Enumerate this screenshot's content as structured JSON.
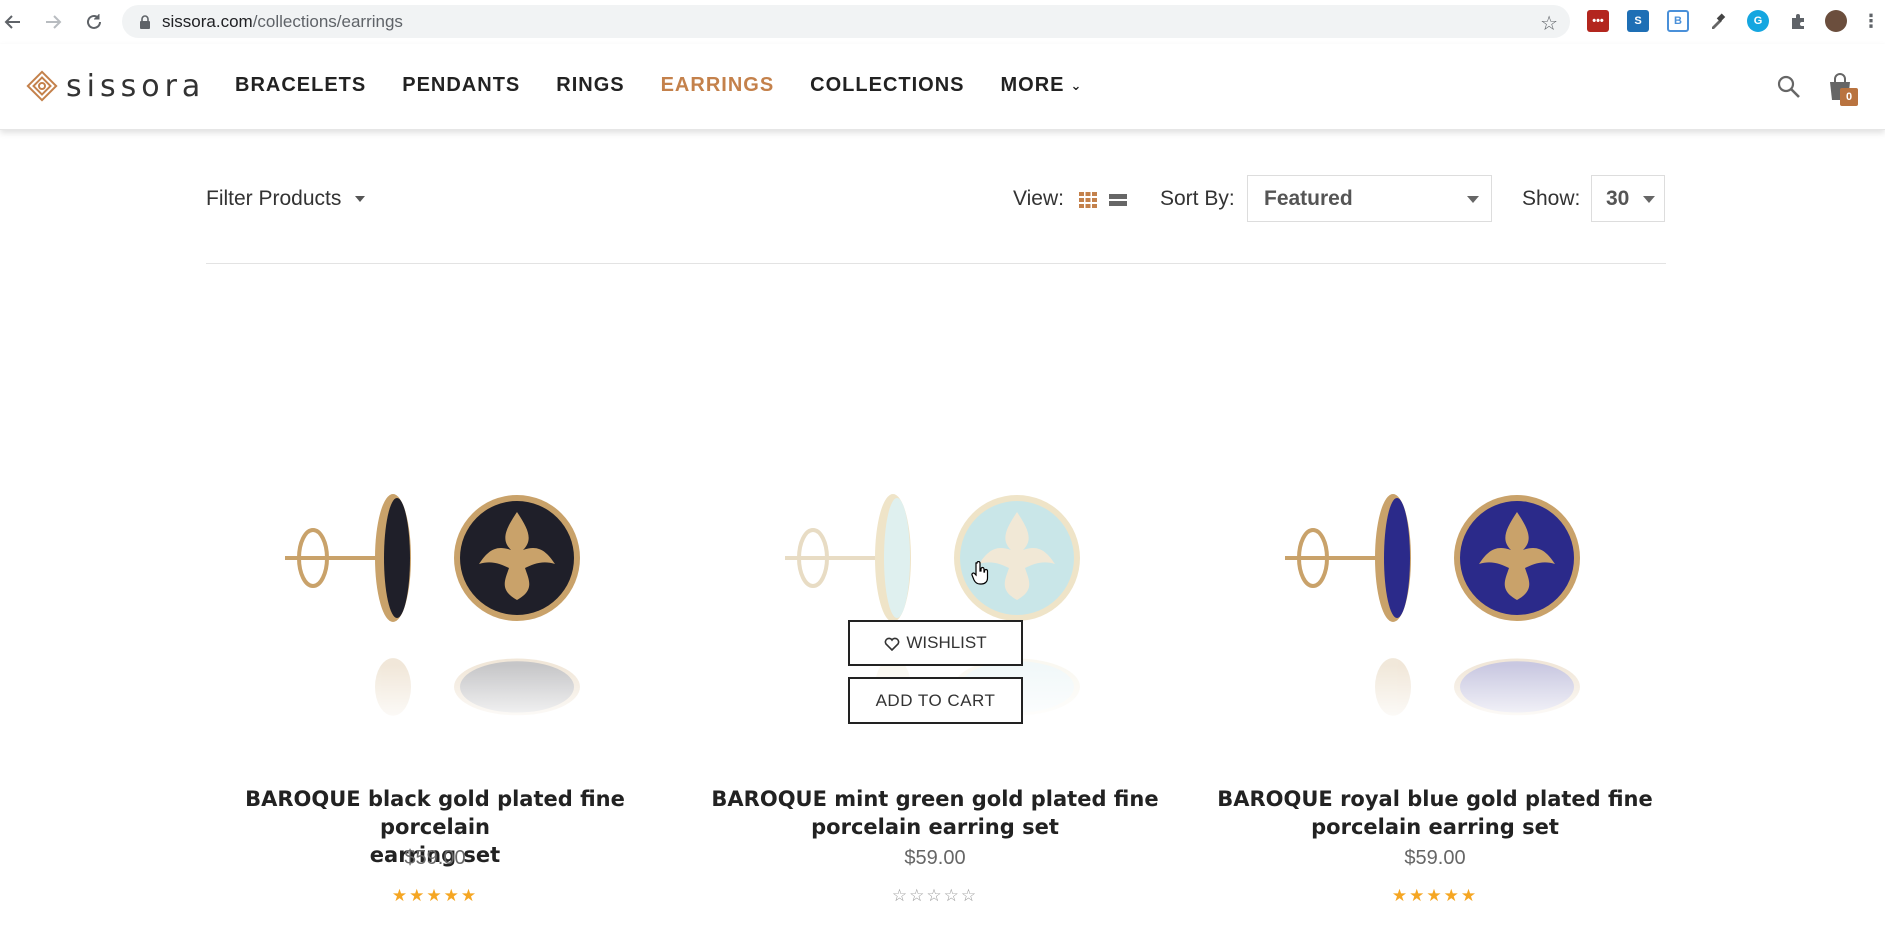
{
  "browser": {
    "url_host": "sissora.com",
    "url_path": "/collections/earrings",
    "back_icon": "back-arrow-icon",
    "forward_icon": "forward-arrow-icon",
    "reload_icon": "reload-icon",
    "bookmark_icon": "star-icon"
  },
  "header": {
    "logo_text": "sissora",
    "nav": [
      {
        "label": "BRACELETS"
      },
      {
        "label": "PENDANTS"
      },
      {
        "label": "RINGS"
      },
      {
        "label": "EARRINGS"
      },
      {
        "label": "COLLECTIONS"
      },
      {
        "label": "MORE"
      }
    ],
    "cart_count": "0"
  },
  "toolbar": {
    "filter_label": "Filter Products",
    "view_label": "View:",
    "sort_label": "Sort By:",
    "sort_value": "Featured",
    "show_label": "Show:",
    "show_value": "30"
  },
  "products": [
    {
      "name_line1": "BAROQUE black gold plated fine porcelain",
      "name_line2": "earring set",
      "price": "$59.00",
      "rating": 5,
      "stars_filled": "★★★★★",
      "stars_empty": ""
    },
    {
      "name_line1": "BAROQUE mint green gold plated fine",
      "name_line2": "porcelain earring set",
      "price": "$59.00",
      "rating": 0,
      "stars_filled": "",
      "stars_empty": "☆☆☆☆☆"
    },
    {
      "name_line1": "BAROQUE royal blue gold plated fine",
      "name_line2": "porcelain earring set",
      "price": "$59.00",
      "rating": 5,
      "stars_filled": "★★★★★",
      "stars_empty": ""
    }
  ],
  "hover_actions": {
    "wishlist_label": "WISHLIST",
    "add_to_cart_label": "ADD TO CART"
  },
  "colors": {
    "accent": "#c4814b",
    "star": "#f5a623",
    "black_enamel": "#1f1f29",
    "mint_enamel": "#c9e6e8",
    "blue_enamel": "#2b2a8a",
    "gold": "#c9a26a"
  }
}
